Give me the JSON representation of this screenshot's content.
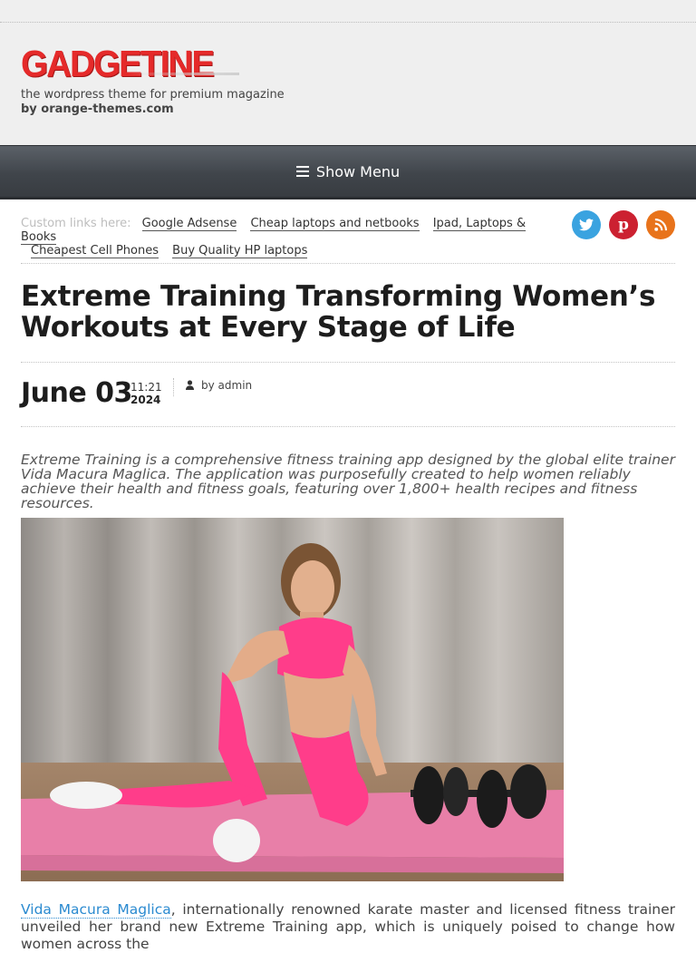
{
  "header": {
    "logo_text": "GADGETINE",
    "tagline": "the wordpress theme for premium magazine",
    "byline": "by orange-themes.com"
  },
  "nav": {
    "menu_label": "Show Menu"
  },
  "custom_links": {
    "lead": "Custom links here:",
    "links": [
      "Google Adsense",
      "Cheap laptops and netbooks",
      "Ipad, Laptops & Books",
      "Cheapest Cell Phones",
      "Buy Quality HP laptops"
    ]
  },
  "social": {
    "twitter": "twitter-icon",
    "pinterest": "pinterest-icon",
    "rss": "rss-icon"
  },
  "article": {
    "title": "Extreme Training Transforming Women’s Workouts at Every Stage of Life",
    "date": "June 03",
    "time": "11:21",
    "year": "2024",
    "author": "by admin",
    "intro": "Extreme Training is a comprehensive fitness training app designed by the global elite trainer Vida Macura Maglica. The application was purposefully created to help women reliably achieve their health and fitness goals, featuring over 1,800+ health recipes and fitness resources.",
    "body_link": "Vida Macura Maglica",
    "body_text": ", internationally renowned karate master and licensed fitness trainer unveiled her brand new Extreme Training app, which is uniquely poised to change how women across the"
  },
  "colors": {
    "brand_red": "#e52a2a",
    "twitter": "#3aa3e0",
    "pinterest": "#cc2131",
    "rss": "#e8731b",
    "link_blue": "#2a8ad0"
  }
}
